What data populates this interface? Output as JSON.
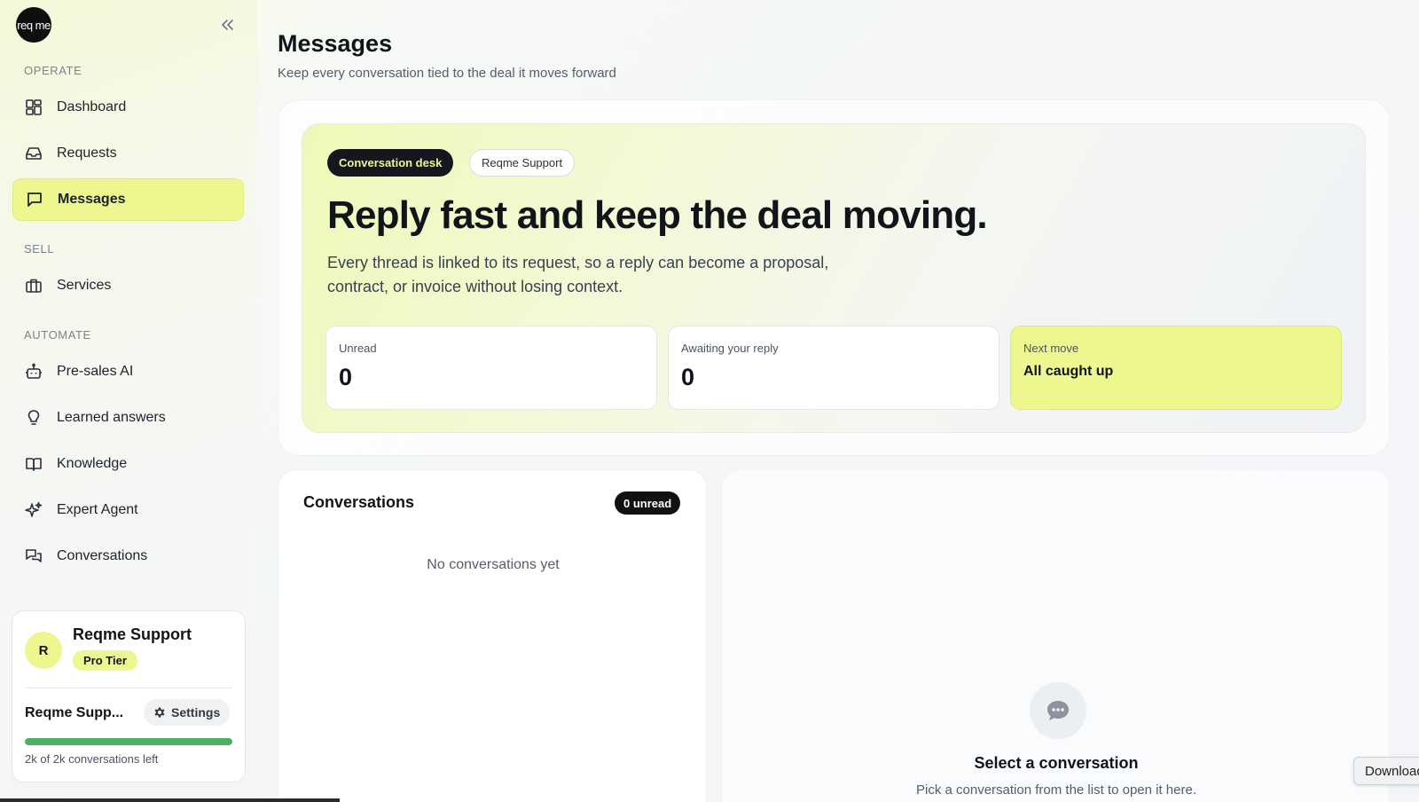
{
  "brand": {
    "logo_text": "req me"
  },
  "sidebar": {
    "sections": [
      {
        "label": "OPERATE"
      },
      {
        "label": "SELL"
      },
      {
        "label": "AUTOMATE"
      }
    ],
    "items": [
      {
        "label": "Dashboard",
        "icon": "dashboard-icon"
      },
      {
        "label": "Requests",
        "icon": "inbox-icon"
      },
      {
        "label": "Messages",
        "icon": "message-icon",
        "active": true
      },
      {
        "label": "Services",
        "icon": "briefcase-icon"
      },
      {
        "label": "Pre-sales AI",
        "icon": "bot-icon"
      },
      {
        "label": "Learned answers",
        "icon": "lightbulb-icon"
      },
      {
        "label": "Knowledge",
        "icon": "book-icon"
      },
      {
        "label": "Expert Agent",
        "icon": "sparkles-icon"
      },
      {
        "label": "Conversations",
        "icon": "chats-icon"
      }
    ],
    "profile": {
      "avatar_letter": "R",
      "name": "Reqme Support",
      "tier": "Pro Tier",
      "org_name": "Reqme Supp...",
      "settings_label": "Settings",
      "usage_text": "2k of 2k conversations left",
      "usage_fraction": 1.0
    }
  },
  "main": {
    "title": "Messages",
    "subtitle": "Keep every conversation tied to the deal it moves forward",
    "hero": {
      "pill_primary": "Conversation desk",
      "pill_secondary": "Reqme Support",
      "headline": "Reply fast and keep the deal moving.",
      "description": "Every thread is linked to its request, so a reply can become a proposal, contract, or invoice without losing context.",
      "stats": [
        {
          "label": "Unread",
          "value": "0"
        },
        {
          "label": "Awaiting your reply",
          "value": "0"
        },
        {
          "label": "Next move",
          "value": "All caught up"
        }
      ]
    },
    "conversations": {
      "title": "Conversations",
      "unread_badge": "0 unread",
      "empty_text": "No conversations yet"
    },
    "detail": {
      "title": "Select a conversation",
      "subtitle": "Pick a conversation from the list to open it here."
    }
  },
  "overlay": {
    "download_label": "Download"
  },
  "colors": {
    "accent": "#eef78f",
    "dark": "#14181c",
    "progress": "#4caf64"
  }
}
